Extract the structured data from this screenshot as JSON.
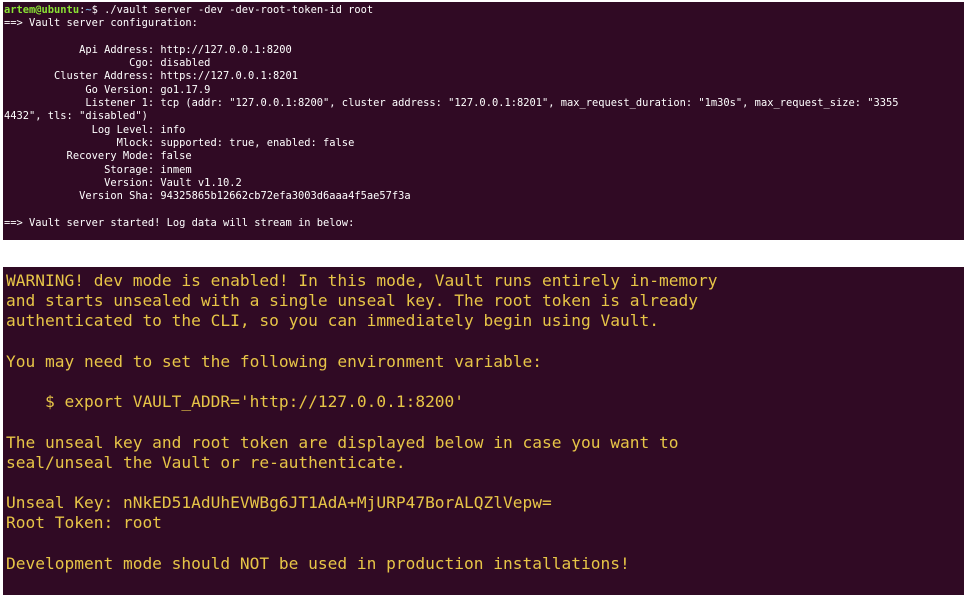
{
  "top_terminal": {
    "prompt": {
      "user_host": "artem@ubuntu",
      "sep": ":",
      "path": "~",
      "symbol": "$ ",
      "command": "./vault server -dev -dev-root-token-id root"
    },
    "lines": [
      "==> Vault server configuration:",
      "",
      "            Api Address: http://127.0.0.1:8200",
      "                    Cgo: disabled",
      "        Cluster Address: https://127.0.0.1:8201",
      "             Go Version: go1.17.9",
      "             Listener 1: tcp (addr: \"127.0.0.1:8200\", cluster address: \"127.0.0.1:8201\", max_request_duration: \"1m30s\", max_request_size: \"3355",
      "4432\", tls: \"disabled\")",
      "              Log Level: info",
      "                  Mlock: supported: true, enabled: false",
      "          Recovery Mode: false",
      "                Storage: inmem",
      "                Version: Vault v1.10.2",
      "            Version Sha: 94325865b12662cb72efa3003d6aaa4f5ae57f3a",
      "",
      "==> Vault server started! Log data will stream in below:"
    ]
  },
  "bottom_terminal": {
    "lines": [
      "WARNING! dev mode is enabled! In this mode, Vault runs entirely in-memory",
      "and starts unsealed with a single unseal key. The root token is already",
      "authenticated to the CLI, so you can immediately begin using Vault.",
      "",
      "You may need to set the following environment variable:",
      "",
      "    $ export VAULT_ADDR='http://127.0.0.1:8200'",
      "",
      "The unseal key and root token are displayed below in case you want to",
      "seal/unseal the Vault or re-authenticate.",
      "",
      "Unseal Key: nNkED51AdUhEVWBg6JT1AdA+MjURP47BorALQZlVepw=",
      "Root Token: root",
      "",
      "Development mode should NOT be used in production installations!"
    ]
  }
}
